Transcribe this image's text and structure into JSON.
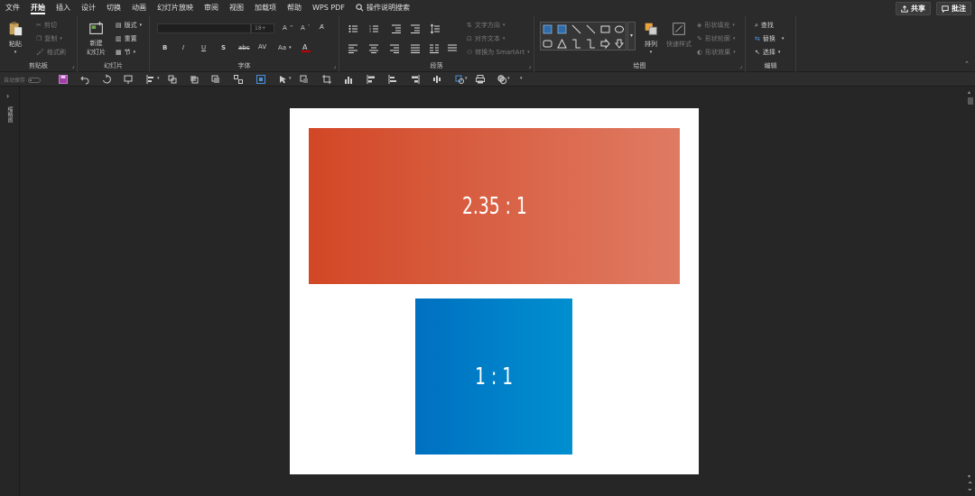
{
  "menu": {
    "tabs": [
      "文件",
      "开始",
      "插入",
      "设计",
      "切换",
      "动画",
      "幻灯片放映",
      "审阅",
      "视图",
      "加载项",
      "帮助",
      "WPS PDF"
    ],
    "active_index": 1,
    "tell_me": "操作说明搜索",
    "share": "共享",
    "comments": "批注"
  },
  "ribbon": {
    "clipboard": {
      "label": "剪贴板",
      "paste": "粘贴",
      "cut": "剪切",
      "copy": "复制",
      "format_painter": "格式刷"
    },
    "slides": {
      "label": "幻灯片",
      "new_slide": "新建",
      "new_slide_2": "幻灯片",
      "layout": "版式",
      "reset": "重置",
      "section": "节"
    },
    "font": {
      "label": "字体",
      "size_placeholder": "18+",
      "bold": "B",
      "italic": "I",
      "underline": "U",
      "strike": "S",
      "shadow": "abc",
      "spacing": "AV",
      "case": "Aa",
      "grow": "A",
      "shrink": "A"
    },
    "paragraph": {
      "label": "段落",
      "text_direction": "文字方向",
      "align_text": "对齐文本",
      "smartart": "转换为 SmartArt"
    },
    "drawing": {
      "label": "绘图",
      "arrange": "排列",
      "quick_styles": "快速样式",
      "shape_fill": "形状填充",
      "shape_outline": "形状轮廓",
      "shape_effects": "形状效果"
    },
    "editing": {
      "label": "编辑",
      "find": "查找",
      "replace": "替换",
      "select": "选择"
    }
  },
  "qat": {
    "autosave": "自动保存"
  },
  "left_pane": {
    "label": "缩略图"
  },
  "slide": {
    "shape_wide_text": "2.35 : 1",
    "shape_square_text": "1 : 1",
    "colors": {
      "wide_start": "#d24726",
      "wide_end": "#df7b63",
      "square_start": "#0070c0",
      "square_end": "#008fd0"
    }
  }
}
